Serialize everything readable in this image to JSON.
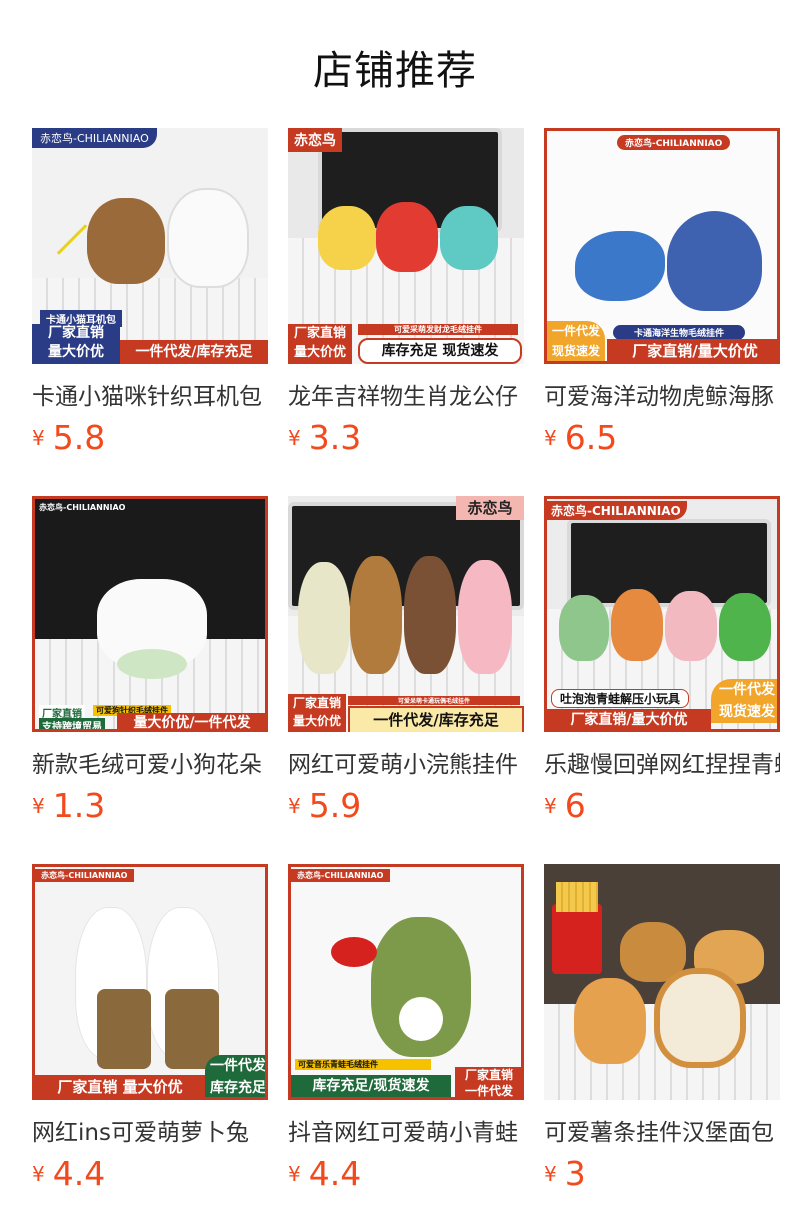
{
  "header": {
    "title": "店铺推荐"
  },
  "currency": "¥",
  "products": [
    {
      "name": "卡通小猫咪针织耳机包",
      "price": "5.8",
      "tags": [
        "赤恋鸟-CHILIANNIAO",
        "卡通小猫耳机包",
        "厂家直销",
        "量大价优",
        "一件代发/库存充足"
      ]
    },
    {
      "name": "龙年吉祥物生肖龙公仔",
      "price": "3.3",
      "tags": [
        "赤恋鸟",
        "厂家直销",
        "量大价优",
        "可爱采萌发财龙毛绒挂件",
        "库存充足  现货速发"
      ]
    },
    {
      "name": "可爱海洋动物虎鲸海豚",
      "price": "6.5",
      "tags": [
        "赤恋鸟-CHILIANNIAO",
        "一件代发",
        "现货速发",
        "卡通海洋生物毛绒挂件",
        "厂家直销/量大价优"
      ]
    },
    {
      "name": "新款毛绒可爱小狗花朵",
      "price": "1.3",
      "tags": [
        "赤恋鸟-CHILIANNIAO",
        "厂家直销",
        "可爱狗针织毛绒挂件",
        "支持跨境贸易",
        "量大价优/一件代发"
      ]
    },
    {
      "name": "网红可爱萌小浣熊挂件",
      "price": "5.9",
      "tags": [
        "赤恋鸟",
        "厂家直销",
        "量大价优",
        "可爱呆萌卡通玩偶毛绒挂件",
        "一件代发/库存充足"
      ]
    },
    {
      "name": "乐趣慢回弹网红捏捏青蛙",
      "price": "6",
      "tags": [
        "赤恋鸟-CHILIANNIAO",
        "吐泡泡青蛙解压小玩具",
        "一件代发",
        "现货速发",
        "厂家直销/量大价优"
      ]
    },
    {
      "name": "网红ins可爱萌萝卜兔",
      "price": "4.4",
      "tags": [
        "赤恋鸟-CHILIANNIAO",
        "一件代发",
        "库存充足",
        "厂家直销 量大价优"
      ]
    },
    {
      "name": "抖音网红可爱萌小青蛙",
      "price": "4.4",
      "tags": [
        "赤恋鸟-CHILIANNIAO",
        "可爱音乐青蛙毛绒挂件",
        "厂家直销",
        "一件代发",
        "库存充足/现货速发"
      ]
    },
    {
      "name": "可爱薯条挂件汉堡面包",
      "price": "3",
      "tags": []
    }
  ],
  "colors": {
    "price": "#f24a1d",
    "brand_blue": "#2a3c86",
    "brand_red": "#c63a22",
    "brand_green": "#1f6a3a"
  }
}
